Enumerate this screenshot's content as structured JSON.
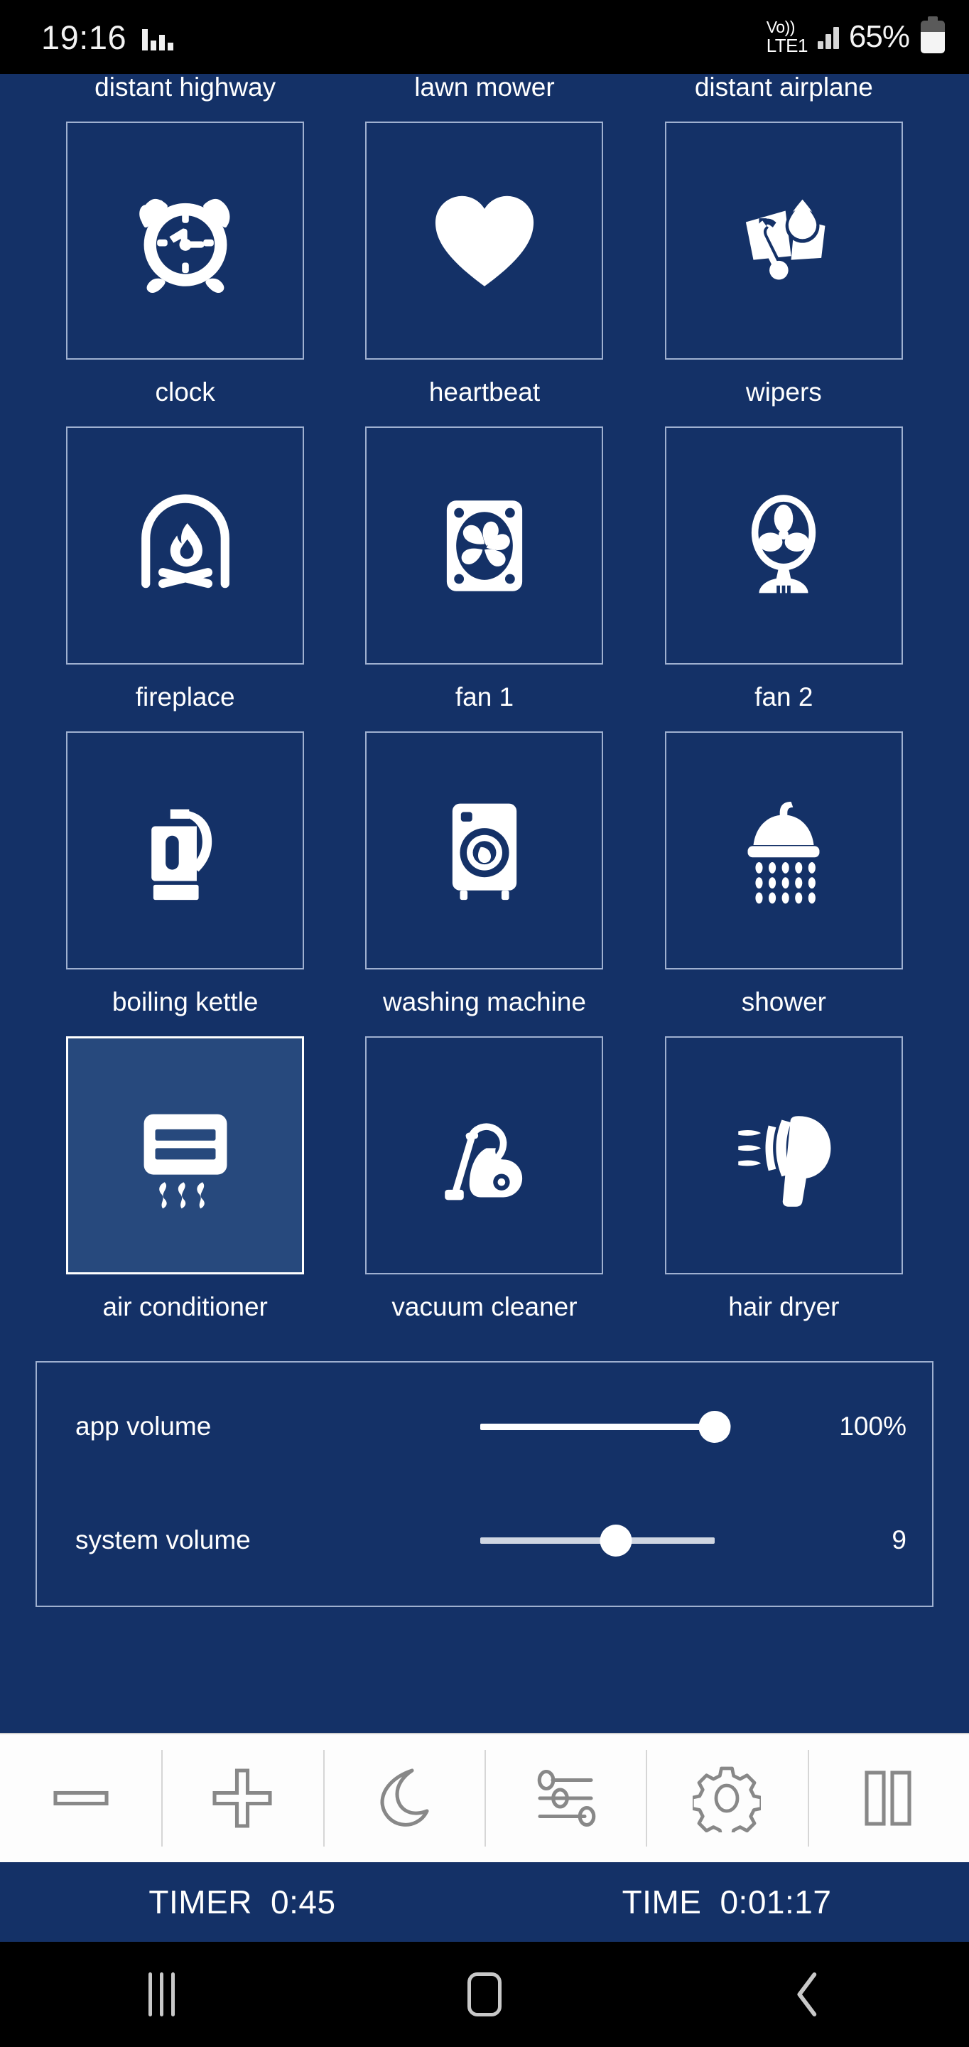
{
  "status_bar": {
    "time": "19:16",
    "equalizer_icon": "equalizer-icon",
    "network_line1": "Vo))",
    "network_line2": "LTE1",
    "battery_percent": "65%",
    "battery_icon": "battery-icon",
    "signal_icon": "signal-bars-icon"
  },
  "sounds": {
    "partial_top_row": [
      {
        "label": "distant highway"
      },
      {
        "label": "lawn mower"
      },
      {
        "label": "distant airplane"
      }
    ],
    "tiles": [
      {
        "label": "clock",
        "icon": "alarm-clock-icon",
        "selected": false
      },
      {
        "label": "heartbeat",
        "icon": "heart-icon",
        "selected": false
      },
      {
        "label": "wipers",
        "icon": "windshield-wiper-icon",
        "selected": false
      },
      {
        "label": "fireplace",
        "icon": "fireplace-icon",
        "selected": false
      },
      {
        "label": "fan 1",
        "icon": "box-fan-icon",
        "selected": false
      },
      {
        "label": "fan 2",
        "icon": "pedestal-fan-icon",
        "selected": false
      },
      {
        "label": "boiling kettle",
        "icon": "kettle-icon",
        "selected": false
      },
      {
        "label": "washing machine",
        "icon": "washing-machine-icon",
        "selected": false
      },
      {
        "label": "shower",
        "icon": "shower-head-icon",
        "selected": false
      },
      {
        "label": "air conditioner",
        "icon": "air-conditioner-icon",
        "selected": true
      },
      {
        "label": "vacuum cleaner",
        "icon": "vacuum-cleaner-icon",
        "selected": false
      },
      {
        "label": "hair dryer",
        "icon": "hair-dryer-icon",
        "selected": false
      }
    ]
  },
  "volume": {
    "app": {
      "label": "app volume",
      "value_text": "100%",
      "percent": 100
    },
    "system": {
      "label": "system volume",
      "value_text": "9",
      "percent": 58
    }
  },
  "toolbar": [
    {
      "name": "minus-icon",
      "title": "decrease"
    },
    {
      "name": "plus-icon",
      "title": "increase"
    },
    {
      "name": "moon-icon",
      "title": "night mode"
    },
    {
      "name": "sliders-icon",
      "title": "mixer"
    },
    {
      "name": "gear-icon",
      "title": "settings"
    },
    {
      "name": "pause-icon",
      "title": "pause"
    }
  ],
  "status_footer": {
    "timer_label": "TIMER",
    "timer_value": "0:45",
    "time_label": "TIME",
    "time_value": "0:01:17"
  },
  "nav_bar": {
    "recents": "recents-icon",
    "home": "home-icon",
    "back": "back-icon"
  },
  "colors": {
    "background": "#143167",
    "tile_selected": "#27497d",
    "tile_border": "#9fb0d0",
    "toolbar_bg": "#fdfdfd",
    "icon_stroke": "#888888",
    "text": "#ffffff"
  }
}
